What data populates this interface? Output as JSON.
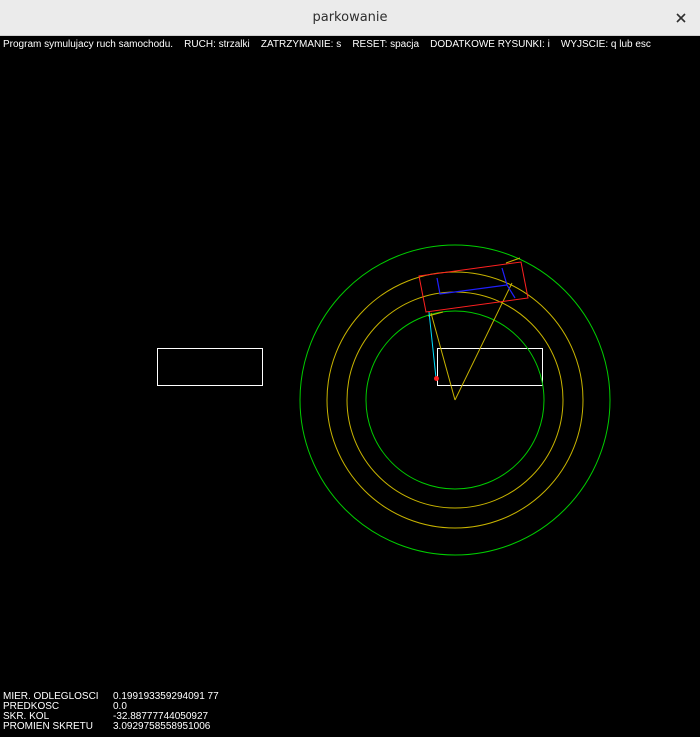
{
  "window": {
    "title": "parkowanie"
  },
  "help_text": "Program symulujacy ruch samochodu.    RUCH: strzalki    ZATRZYMANIE: s    RESET: spacja    DODATKOWE RYSUNKI: i    WYJSCIE: q lub esc",
  "stats": [
    {
      "label": "MIER. ODLEGLOSCI",
      "value": "0.199193359294091 77"
    },
    {
      "label": "PREDKOSC",
      "value": "0.0"
    },
    {
      "label": "SKR. KOL",
      "value": "-32.88777744050927"
    },
    {
      "label": "PROMIEN SKRETU",
      "value": "3.0929758558951006"
    }
  ],
  "colors": {
    "outer_circle": "#00cc00",
    "inner_circle": "#00cc00",
    "middle_circles": "#c8b400",
    "car_body": "#ff2020",
    "axle": "#2020ff",
    "sensor_line": "#00e0ff",
    "sensor_point": "#ff2020",
    "parking_spot": "#ffffff"
  }
}
